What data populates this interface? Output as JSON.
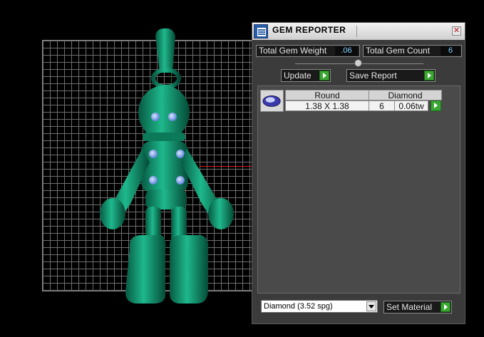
{
  "panel": {
    "title": "GEM REPORTER",
    "close_glyph": "✕",
    "icons": {
      "app": "gem-reporter-icon",
      "close": "close-icon"
    }
  },
  "stats": {
    "total_weight_label": "Total Gem Weight",
    "total_weight_value": ".06",
    "total_count_label": "Total Gem Count",
    "total_count_value": "6"
  },
  "actions": {
    "update_label": "Update",
    "save_report_label": "Save Report",
    "set_material_label": "Set Material"
  },
  "gem_table": {
    "rows": [
      {
        "shape": "Round",
        "material": "Diamond",
        "size": "1.38 X 1.38",
        "count": "6",
        "weight": "0.06tw"
      }
    ]
  },
  "material_select": {
    "selected": "Diamond      (3.52 spg)"
  },
  "colors": {
    "panel_bg": "#3b3b3b",
    "value_text": "#7fd4ff",
    "go_button": "#3aa832",
    "model": "#15a07a"
  }
}
